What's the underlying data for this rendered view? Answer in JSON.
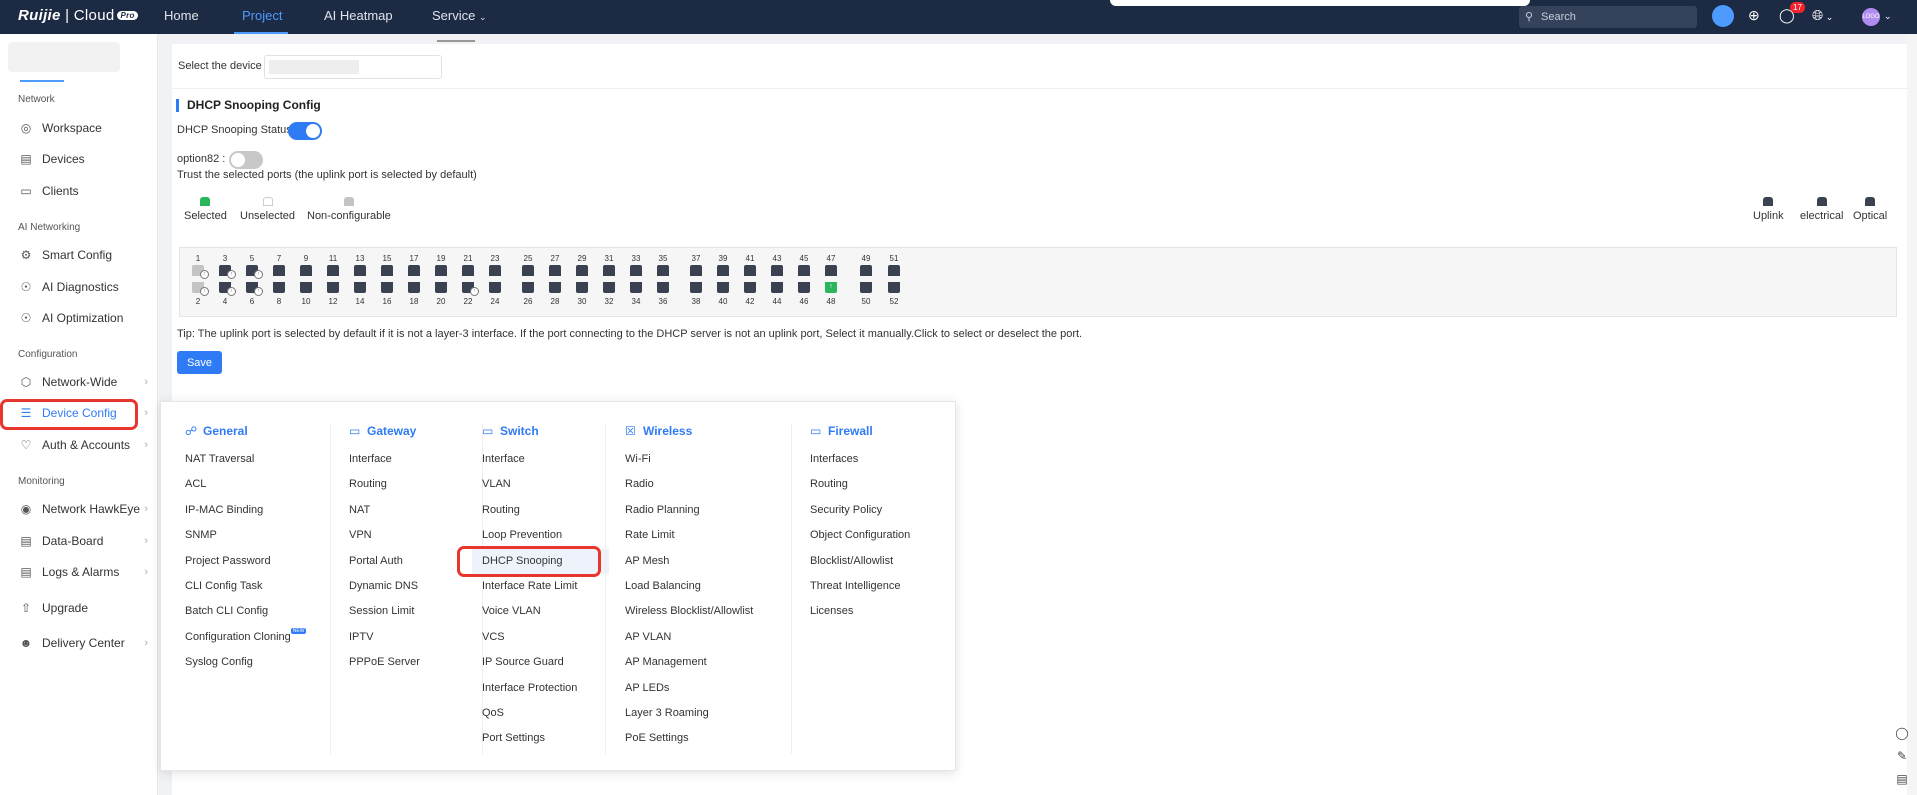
{
  "topbar": {
    "brand": "Ruijie",
    "brand_cloud": "Cloud",
    "brand_badge": "Pro",
    "nav": [
      {
        "label": "Home"
      },
      {
        "label": "Project"
      },
      {
        "label": "AI Heatmap"
      },
      {
        "label": "Service"
      }
    ],
    "search_placeholder": "Search",
    "notification_count": "17",
    "avatar_text": "LOGO"
  },
  "sidebar": {
    "sections": [
      {
        "label": "Network",
        "items": [
          "Workspace",
          "Devices",
          "Clients"
        ]
      },
      {
        "label": "AI Networking",
        "items": [
          "Smart Config",
          "AI Diagnostics",
          "AI Optimization"
        ]
      },
      {
        "label": "Configuration",
        "items": [
          "Network-Wide",
          "Device Config",
          "Auth & Accounts"
        ]
      },
      {
        "label": "Monitoring",
        "items": [
          "Network HawkEye",
          "Data-Board",
          "Logs & Alarms",
          "Upgrade",
          "Delivery Center"
        ]
      }
    ],
    "active_item": "Device Config"
  },
  "device": {
    "label": "Select the device :"
  },
  "dhcp": {
    "title": "DHCP Snooping Config",
    "status_label": "DHCP Snooping Status :",
    "status_on": true,
    "option82_label": "option82 :",
    "option82_on": false,
    "trust_text": "Trust the selected ports (the uplink port is selected by default)",
    "legend_left": [
      "Selected",
      "Unselected",
      "Non-configurable"
    ],
    "legend_right": [
      "Uplink",
      "electrical",
      "Optical"
    ],
    "ports_top": [
      "1",
      "3",
      "5",
      "7",
      "9",
      "11",
      "13",
      "15",
      "17",
      "19",
      "21",
      "23",
      "25",
      "27",
      "29",
      "31",
      "33",
      "35",
      "37",
      "39",
      "41",
      "43",
      "45",
      "47",
      "49",
      "51"
    ],
    "ports_bottom": [
      "2",
      "4",
      "6",
      "8",
      "10",
      "12",
      "14",
      "16",
      "18",
      "20",
      "22",
      "24",
      "26",
      "28",
      "30",
      "32",
      "34",
      "36",
      "38",
      "40",
      "42",
      "44",
      "46",
      "48",
      "50",
      "52"
    ],
    "tip": "Tip: The uplink port is selected by default if it is not a layer-3 interface. If the port connecting to the DHCP server is not an uplink port, Select it manually.Click to select or deselect the port.",
    "save_label": "Save"
  },
  "menu": {
    "columns": [
      {
        "title": "General",
        "icon": "general-icon",
        "items": [
          "NAT Traversal",
          "ACL",
          "IP-MAC Binding",
          "SNMP",
          "Project Password",
          "CLI Config Task",
          "Batch CLI Config",
          "Configuration Cloning",
          "Syslog Config"
        ]
      },
      {
        "title": "Gateway",
        "icon": "gateway-icon",
        "items": [
          "Interface",
          "Routing",
          "NAT",
          "VPN",
          "Portal Auth",
          "Dynamic DNS",
          "Session Limit",
          "IPTV",
          "PPPoE Server"
        ]
      },
      {
        "title": "Switch",
        "icon": "switch-icon",
        "items": [
          "Interface",
          "VLAN",
          "Routing",
          "Loop Prevention",
          "DHCP Snooping",
          "Interface Rate Limit",
          "Voice VLAN",
          "VCS",
          "IP Source Guard",
          "Interface Protection",
          "QoS",
          "Port Settings"
        ]
      },
      {
        "title": "Wireless",
        "icon": "wireless-icon",
        "items": [
          "Wi-Fi",
          "Radio",
          "Radio Planning",
          "Rate Limit",
          "AP Mesh",
          "Load Balancing",
          "Wireless Blocklist/Allowlist",
          "AP VLAN",
          "AP Management",
          "AP LEDs",
          "Layer 3 Roaming",
          "PoE Settings"
        ]
      },
      {
        "title": "Firewall",
        "icon": "firewall-icon",
        "items": [
          "Interfaces",
          "Routing",
          "Security Policy",
          "Object Configuration",
          "Blocklist/Allowlist",
          "Threat Intelligence",
          "Licenses"
        ]
      }
    ],
    "new_tag": "NEW",
    "active_item": "DHCP Snooping"
  },
  "colors": {
    "accent": "#2f7bf5",
    "topbar": "#1d2a44",
    "highlight": "#e8352e",
    "port_dark": "#3a4252",
    "port_selected": "#2bb55c"
  }
}
